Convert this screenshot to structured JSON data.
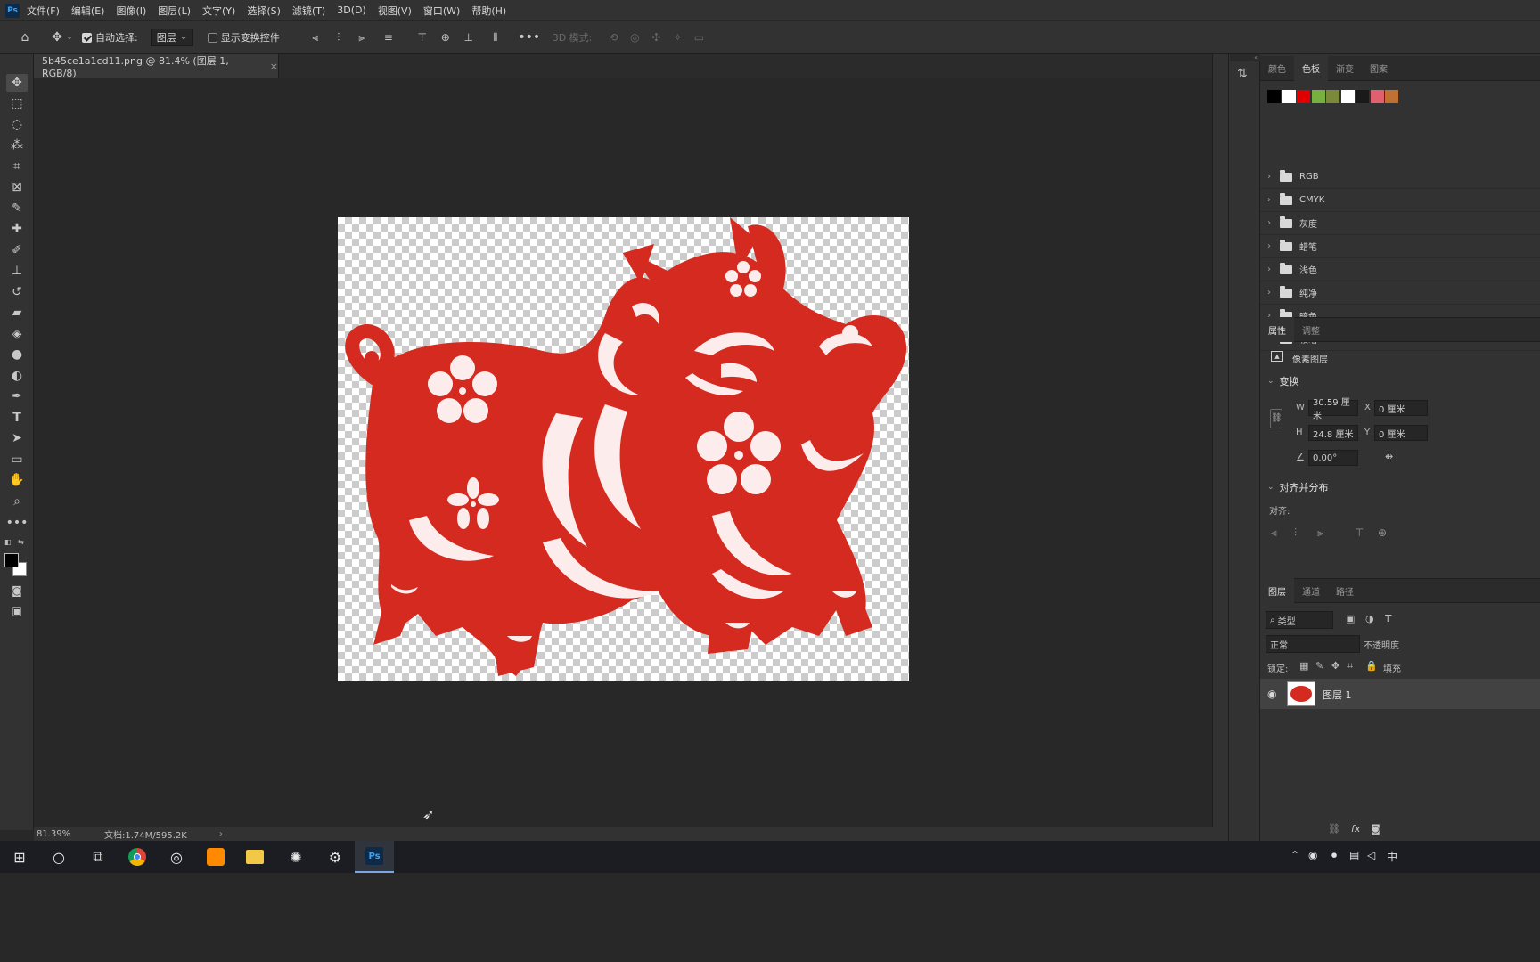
{
  "menu": {
    "items": [
      "文件(F)",
      "编辑(E)",
      "图像(I)",
      "图层(L)",
      "文字(Y)",
      "选择(S)",
      "滤镜(T)",
      "3D(D)",
      "视图(V)",
      "窗口(W)",
      "帮助(H)"
    ]
  },
  "options": {
    "auto_select_label": "自动选择:",
    "auto_select_value": "图层",
    "show_transform_label": "显示变换控件",
    "mode_3d_label": "3D 模式:"
  },
  "document": {
    "tab_title": "5b45ce1a1cd11.png @ 81.4% (图层 1, RGB/8)",
    "close_glyph": "×"
  },
  "status": {
    "zoom": "81.39%",
    "doc_info": "文档:1.74M/595.2K",
    "arrow": "›"
  },
  "swatches_panel": {
    "tabs": [
      "颜色",
      "色板",
      "渐变",
      "图案"
    ],
    "active_tab": 1,
    "colors": [
      "#000000",
      "#ffffff",
      "#e00000",
      "#78b040",
      "#7a8a3a",
      "#ffffff",
      "#1a1a1a",
      "#e06070",
      "#c07030"
    ],
    "groups": [
      "RGB",
      "CMYK",
      "灰度",
      "蜡笔",
      "浅色",
      "纯净",
      "暗色",
      "较暗"
    ]
  },
  "properties_panel": {
    "tabs": [
      "属性",
      "调整"
    ],
    "layer_type": "像素图层",
    "transform_title": "变换",
    "w_label": "W",
    "w_value": "30.59 厘米",
    "x_label": "X",
    "x_value": "0 厘米",
    "h_label": "H",
    "h_value": "24.8 厘米",
    "y_label": "Y",
    "y_value": "0 厘米",
    "angle_value": "0.00°",
    "align_title": "对齐并分布",
    "align_label": "对齐:"
  },
  "layers_panel": {
    "tabs": [
      "图层",
      "通道",
      "路径"
    ],
    "filter_value": "类型",
    "blend_mode": "正常",
    "opacity_label": "不透明度",
    "lock_label": "锁定:",
    "fill_label": "填充",
    "layer_name": "图层 1"
  },
  "colors": {
    "paper_cut_red": "#d52a20"
  }
}
